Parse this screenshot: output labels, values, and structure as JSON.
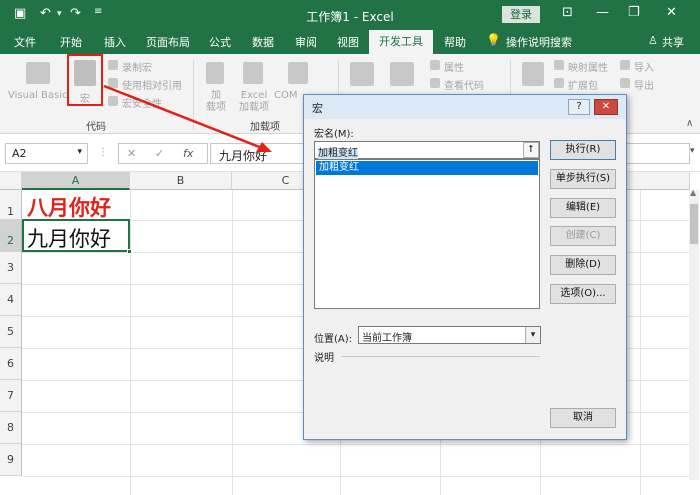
{
  "title_bar": {
    "doc_title": "工作簿1 - Excel",
    "login_label": "登录"
  },
  "tabs": [
    "文件",
    "开始",
    "插入",
    "页面布局",
    "公式",
    "数据",
    "审阅",
    "视图",
    "开发工具",
    "帮助",
    "操作说明搜索"
  ],
  "share_label": "共享",
  "ribbon": {
    "vb_label": "Visual Basic",
    "macro_label": "宏",
    "record_label": "录制宏",
    "relative_label": "使用相对引用",
    "security_label": "宏安全性",
    "group_code": "代码",
    "addin_label": "加\n载项",
    "excel_addin_label": "Excel\n加载项",
    "com_label": "COM",
    "group_addins": "加载项",
    "properties_label": "属性",
    "viewcode_label": "查看代码",
    "map_props_label": "映射属性",
    "expansion_label": "扩展包",
    "import_label": "导入",
    "export_label": "导出"
  },
  "formula_bar": {
    "name_box": "A2",
    "fx": "fx",
    "formula": "九月你好"
  },
  "grid": {
    "columns": [
      "A",
      "B",
      "C"
    ],
    "rows": [
      "1",
      "2",
      "3",
      "4",
      "5",
      "6",
      "7",
      "8",
      "9"
    ],
    "a1": "八月你好",
    "a2": "九月你好",
    "a1_color": "#e32119"
  },
  "dialog": {
    "title": "宏",
    "help": "?",
    "close": "✕",
    "macro_name_label": "宏名(M):",
    "macro_name_value": "加粗变红",
    "list_items": [
      "加粗变红"
    ],
    "run": "执行(R)",
    "step": "单步执行(S)",
    "edit": "编辑(E)",
    "create": "创建(C)",
    "delete": "删除(D)",
    "options": "选项(O)...",
    "location_label": "位置(A):",
    "location_value": "当前工作簿",
    "description_label": "说明",
    "cancel": "取消"
  },
  "colors": {
    "excel_green": "#217346",
    "annotation_red": "#e32119",
    "selection_blue": "#0078d7"
  }
}
